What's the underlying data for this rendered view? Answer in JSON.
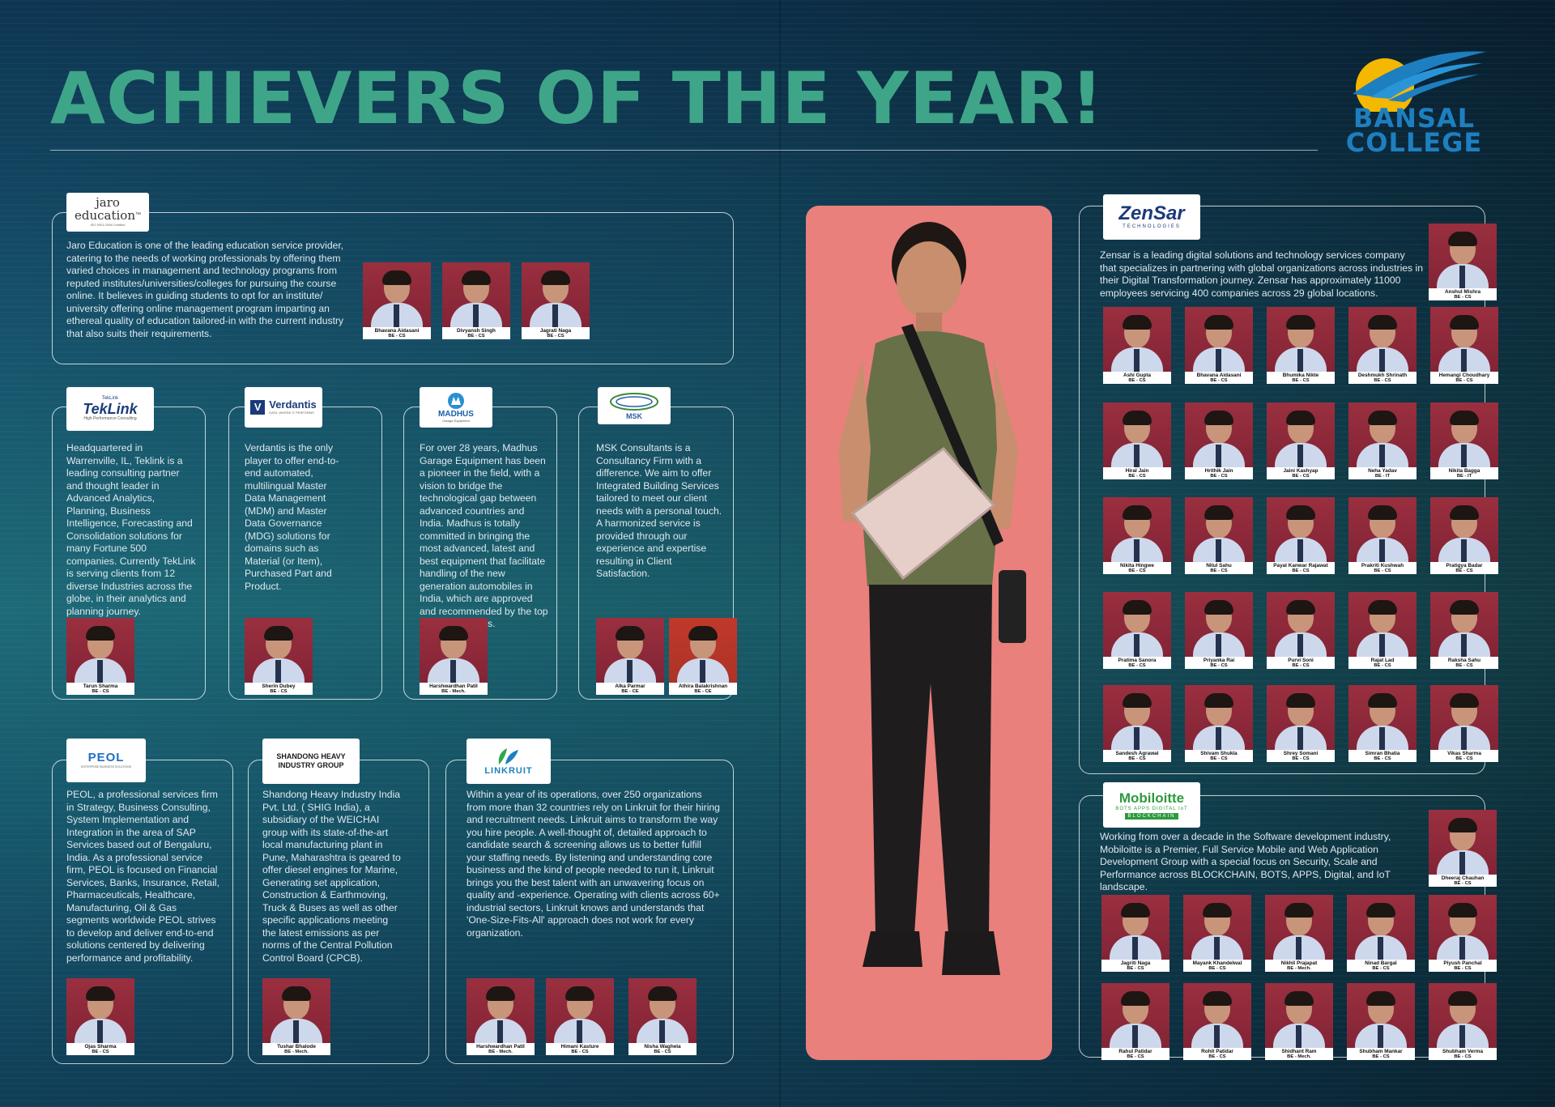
{
  "header": {
    "title": "ACHIEVERS OF THE YEAR!",
    "college_logo": {
      "line1": "BANSAL",
      "line2": "COLLEGE",
      "icon": "sun-wing-logo-icon"
    }
  },
  "companies": {
    "jaro": {
      "logo": {
        "line1": "jaro",
        "line2": "education",
        "tm": "™",
        "tagline": "ISO 9001:2008 Certified"
      },
      "description": "Jaro Education is one of the leading education service provider, catering to the needs of working professionals by offering them varied choices in management and technology programs from reputed institutes/universities/colleges for pursuing the course online. It believes in guiding students to opt for an institute/ university offering online management program imparting an ethereal quality of education tailored-in with the current industry that also suits their requirements.",
      "students": [
        {
          "name": "Bhavana Aidasani",
          "degree": "BE - CS"
        },
        {
          "name": "Divyansh Singh",
          "degree": "BE - CS"
        },
        {
          "name": "Jagrati Naga",
          "degree": "BE - CS"
        }
      ]
    },
    "teklink": {
      "logo": {
        "small": "TekLink",
        "name": "TekLink",
        "tagline": "High Performance Consulting"
      },
      "description": "Headquartered in Warrenville, IL, Teklink is a leading consulting partner and thought leader in Advanced Analytics, Planning, Business Intelligence, Forecasting and Consolidation solutions for many Fortune 500 companies. Currently TekLink is serving clients from 12 diverse Industries across the globe, in their analytics and planning journey.",
      "students": [
        {
          "name": "Tarun Sharma",
          "degree": "BE - CS"
        }
      ]
    },
    "verdantis": {
      "logo": {
        "mark": "V",
        "name": "Verdantis",
        "tagline": "DATA. WHERE IT PERFORMS"
      },
      "description": "Verdantis is the only player to offer end-to-end automated, multilingual Master Data Management (MDM) and Master Data Governance (MDG) solutions for domains such as Material (or Item), Purchased Part and Product.",
      "students": [
        {
          "name": "Sherin Dubey",
          "degree": "BE - CS"
        }
      ]
    },
    "madhus": {
      "logo": {
        "name": "MADHUS",
        "tagline": "Garage Equipment"
      },
      "description": "For over 28 years, Madhus Garage Equipment has been a pioneer in the field, with a vision to bridge the technological gap between advanced countries and India. Madhus is totally committed in bringing the most advanced, latest and best equipment that facilitate handling of the new generation automobiles in India, which are approved and recommended by the top luxury marquees.",
      "students": [
        {
          "name": "Harshwardhan Patil",
          "degree": "BE - Mech."
        }
      ]
    },
    "msk": {
      "logo": {
        "name": "MSK"
      },
      "description": "MSK Consultants is a Consultancy Firm with a difference. We aim to offer Integrated Building Services tailored to meet our client needs with a personal touch. A harmonized service is provided through our experience and expertise resulting in Client Satisfaction.",
      "students": [
        {
          "name": "Alka Parmar",
          "degree": "BE - CE"
        },
        {
          "name": "Athira Balakrishnan",
          "degree": "BE - CE"
        }
      ]
    },
    "peol": {
      "logo": {
        "name": "PEOL",
        "tagline": "ENTERPRISE BUSINESS SOLUTIONS"
      },
      "description": "PEOL, a professional services firm in Strategy, Business Consulting, System Implementation and Integration in the area of SAP Services based out of Bengaluru, India. As a professional service firm, PEOL is focused on Financial Services, Banks, Insurance, Retail, Pharmaceuticals, Healthcare, Manufacturing, Oil & Gas segments worldwide PEOL strives to develop and deliver end-to-end solutions centered by delivering performance and profitability.",
      "students": [
        {
          "name": "Ojas Sharma",
          "degree": "BE - CS"
        }
      ]
    },
    "shandong": {
      "logo": {
        "line1": "SHANDONG HEAVY",
        "line2": "INDUSTRY GROUP"
      },
      "description": "Shandong Heavy Industry India Pvt. Ltd. ( SHIG India), a subsidiary of the WEICHAI group with its state-of-the-art local manufacturing plant in Pune, Maharashtra is geared to offer diesel engines for Marine, Generating set application, Construction & Earthmoving, Truck & Buses as well as other specific applications meeting the latest emissions as per norms of the Central Pollution Control Board (CPCB).",
      "students": [
        {
          "name": "Tushar Bhalode",
          "degree": "BE - Mech."
        }
      ]
    },
    "linkruit": {
      "logo": {
        "name": "LINKRUIT"
      },
      "description": "Within a year of its operations, over 250 organizations from more than 32 countries rely on Linkruit for their hiring and recruitment needs. Linkruit aims to transform the way you hire people. A well-thought of, detailed approach to candidate search & screening allows us to better fulfill your staffing needs. By listening and understanding core business and the kind of people needed to run it, Linkruit brings you the best talent with an unwavering focus on quality and -experience. Operating with clients across 60+ industrial sectors, Linkruit knows and understands that 'One-Size-Fits-All' approach does not work for every organization.",
      "students": [
        {
          "name": "Harshwardhan Patil",
          "degree": "BE - Mech."
        },
        {
          "name": "Himani Kasture",
          "degree": "BE - CS"
        },
        {
          "name": "Nisha Waghela",
          "degree": "BE - CS"
        }
      ]
    },
    "zensar": {
      "logo": {
        "name": "ZenSar",
        "tagline": "TECHNOLOGIES"
      },
      "description": "Zensar is a leading digital solutions and technology services company that specializes in partnering with global organizations across industries in their Digital Transformation journey. Zensar has approximately 11000 employees servicing 400 companies across 29 global locations.",
      "featured": {
        "name": "Anshul Mishra",
        "degree": "BE - CS"
      },
      "students": [
        {
          "name": "Ashi Gupta",
          "degree": "BE - CS"
        },
        {
          "name": "Bhavana Aidasani",
          "degree": "BE - CS"
        },
        {
          "name": "Bhumika Nikte",
          "degree": "BE - CS"
        },
        {
          "name": "Deshmukh Shrinath",
          "degree": "BE - CS"
        },
        {
          "name": "Hemangi Choudhary",
          "degree": "BE - CS"
        },
        {
          "name": "Hiral Jain",
          "degree": "BE - CS"
        },
        {
          "name": "Hrithik Jain",
          "degree": "BE - CS"
        },
        {
          "name": "Jaini Kashyap",
          "degree": "BE - CS"
        },
        {
          "name": "Neha Yadav",
          "degree": "BE - IT"
        },
        {
          "name": "Nikita Bagga",
          "degree": "BE - IT"
        },
        {
          "name": "Nikita Hingwe",
          "degree": "BE - CS"
        },
        {
          "name": "Nitul Sahu",
          "degree": "BE - CS"
        },
        {
          "name": "Payal Kanwar Rajawat",
          "degree": "BE - CS"
        },
        {
          "name": "Prakriti Kushwah",
          "degree": "BE - CS"
        },
        {
          "name": "Pratigya Badar",
          "degree": "BE - CS"
        },
        {
          "name": "Pratima Sanora",
          "degree": "BE - CS"
        },
        {
          "name": "Priyanka Rai",
          "degree": "BE - CS"
        },
        {
          "name": "Purvi Soni",
          "degree": "BE - CS"
        },
        {
          "name": "Rajat Lad",
          "degree": "BE - CS"
        },
        {
          "name": "Raksha Sahu",
          "degree": "BE - CS"
        },
        {
          "name": "Sandesh Agrawal",
          "degree": "BE - CS"
        },
        {
          "name": "Shivam Shukla",
          "degree": "BE - CS"
        },
        {
          "name": "Shrey Somani",
          "degree": "BE - CS"
        },
        {
          "name": "Simran Bhatia",
          "degree": "BE - CS"
        },
        {
          "name": "Vikas Sharma",
          "degree": "BE - CS"
        }
      ]
    },
    "mobiloitte": {
      "logo": {
        "name": "Mobiloitte",
        "tagline": "BOTS APPS DIGITAL IoT",
        "tagline2": "BLOCKCHAIN"
      },
      "description": "Working from over a decade in the Software development industry, Mobiloitte is a Premier, Full Service Mobile and Web Application Development Group with a special focus on Security, Scale and Performance across BLOCKCHAIN, BOTS, APPS, Digital, and IoT landscape.",
      "featured": {
        "name": "Dheeraj Chauhan",
        "degree": "BE - CS"
      },
      "students": [
        {
          "name": "Jagriti Naga",
          "degree": "BE - CS"
        },
        {
          "name": "Mayank Khandelwal",
          "degree": "BE - CS"
        },
        {
          "name": "Nikhil Prajapat",
          "degree": "BE - Mech."
        },
        {
          "name": "Ninad Bargal",
          "degree": "BE - CS"
        },
        {
          "name": "Piyush Panchal",
          "degree": "BE - CS"
        },
        {
          "name": "Rahul Patidar",
          "degree": "BE - CS"
        },
        {
          "name": "Rohit Patidar",
          "degree": "BE - CS"
        },
        {
          "name": "Shidhant Ram",
          "degree": "BE - Mech."
        },
        {
          "name": "Shubham Mankar",
          "degree": "BE - CS"
        },
        {
          "name": "Shubham Verma",
          "degree": "BE - CS"
        }
      ]
    }
  },
  "colors": {
    "title": "#3fa588",
    "background_top": "#0d3552",
    "background_mid": "#1d6a78",
    "photo_backdrop": "#9a2f3f",
    "model_panel": "#e9807c",
    "college_logo": "#1e7fc0",
    "college_sun": "#f5b800"
  }
}
